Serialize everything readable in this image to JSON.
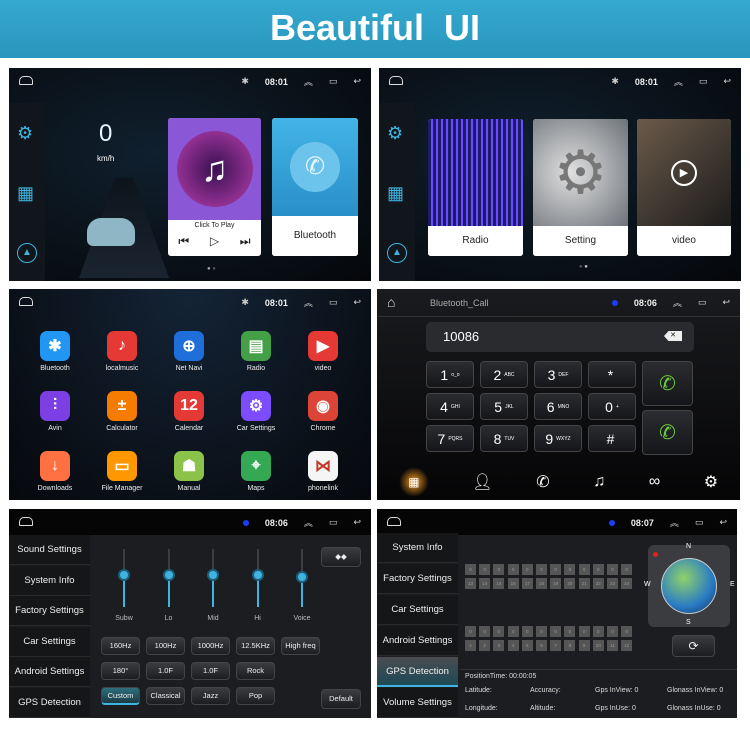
{
  "banner": {
    "title": "Beautiful  UI"
  },
  "home": {
    "time": "08:01",
    "speed": "0",
    "speed_unit": "km/h",
    "music_label": "Click To Play",
    "bt_label": "Bluetooth"
  },
  "home2": {
    "time": "08:01",
    "cards": [
      {
        "label": "Radio"
      },
      {
        "label": "Setting"
      },
      {
        "label": "video"
      }
    ]
  },
  "apps": {
    "time": "08:01",
    "items": [
      {
        "label": "Bluetooth",
        "color": "#2196f3",
        "icon": "bluetooth-icon",
        "glyph": "✱"
      },
      {
        "label": "localmusic",
        "color": "#e53935",
        "icon": "music-icon",
        "glyph": "♪"
      },
      {
        "label": "Net Navi",
        "color": "#1e6fd9",
        "icon": "navigation-icon",
        "glyph": "⊕"
      },
      {
        "label": "Radio",
        "color": "#43a047",
        "icon": "radio-icon",
        "glyph": "▤"
      },
      {
        "label": "video",
        "color": "#e53935",
        "icon": "video-icon",
        "glyph": "▶"
      },
      {
        "label": "Avin",
        "color": "#7b3fe4",
        "icon": "equalizer-icon",
        "glyph": "⫶"
      },
      {
        "label": "Calculator",
        "color": "#f57c00",
        "icon": "calculator-icon",
        "glyph": "±"
      },
      {
        "label": "Calendar",
        "color": "#e53935",
        "icon": "calendar-icon",
        "glyph": "12"
      },
      {
        "label": "Car Settings",
        "color": "#7c4dff",
        "icon": "gear-icon",
        "glyph": "⚙"
      },
      {
        "label": "Chrome",
        "color": "#db4437",
        "icon": "chrome-icon",
        "glyph": "◉"
      },
      {
        "label": "Downloads",
        "color": "#ff7043",
        "icon": "download-icon",
        "glyph": "↓"
      },
      {
        "label": "File Manager",
        "color": "#ff9800",
        "icon": "folder-icon",
        "glyph": "▭"
      },
      {
        "label": "Manual",
        "color": "#8bc34a",
        "icon": "android-icon",
        "glyph": "☗"
      },
      {
        "label": "Maps",
        "color": "#34a853",
        "icon": "maps-icon",
        "glyph": "⌖"
      },
      {
        "label": "phonelink",
        "color": "#f5f5f5",
        "icon": "phonelink-icon",
        "glyph": "⋈"
      }
    ]
  },
  "dialer": {
    "title": "Bluetooth_Call",
    "time": "08:06",
    "number": "10086",
    "keys": [
      {
        "d": "1",
        "s": "ᴏ_ᴏ"
      },
      {
        "d": "2",
        "s": "ABC"
      },
      {
        "d": "3",
        "s": "DEF"
      },
      {
        "d": "*",
        "s": ""
      },
      {
        "d": "4",
        "s": "GHI"
      },
      {
        "d": "5",
        "s": "JKL"
      },
      {
        "d": "6",
        "s": "MNO"
      },
      {
        "d": "0",
        "s": "+"
      },
      {
        "d": "7",
        "s": "PQRS"
      },
      {
        "d": "8",
        "s": "TUV"
      },
      {
        "d": "9",
        "s": "WXYZ"
      },
      {
        "d": "#",
        "s": ""
      }
    ],
    "tabs": [
      "dialpad-icon",
      "contacts-icon",
      "call-log-icon",
      "music-icon",
      "link-icon",
      "gear-icon"
    ],
    "active_tab": "#f39a1e",
    "call_color": "#6cc93a"
  },
  "sound": {
    "time": "08:06",
    "menu": [
      "Sound Settings",
      "System Info",
      "Factory Settings",
      "Car Settings",
      "Android Settings",
      "GPS Detection"
    ],
    "sliders": [
      {
        "label": "Subw",
        "level": 0.55
      },
      {
        "label": "Lo",
        "level": 0.55
      },
      {
        "label": "Mid",
        "level": 0.55
      },
      {
        "label": "Hi",
        "level": 0.55
      },
      {
        "label": "Voice",
        "level": 0.52
      }
    ],
    "row1": [
      "160Hz",
      "100Hz",
      "1000Hz",
      "12.5KHz",
      "High freq"
    ],
    "row2": [
      "180°",
      "1.0F",
      "1.0F",
      "Rock"
    ],
    "row3": [
      "Custom",
      "Classical",
      "Jazz",
      "Pop"
    ],
    "selected_preset": "Custom",
    "default_label": "Default",
    "accent": "#3fb4e0"
  },
  "gps": {
    "time": "08:07",
    "menu": [
      "System Info",
      "Factory Settings",
      "Car Settings",
      "Android Settings",
      "GPS Detection",
      "Volume Settings"
    ],
    "active": "GPS Detection",
    "top_values": [
      "0",
      "0",
      "0",
      "0",
      "0",
      "0",
      "0",
      "0",
      "0",
      "0",
      "0",
      "0"
    ],
    "top_ids": [
      "13",
      "14",
      "15",
      "16",
      "17",
      "18",
      "19",
      "20",
      "21",
      "22",
      "23",
      "24"
    ],
    "bot_values": [
      "0",
      "0",
      "0",
      "0",
      "0",
      "0",
      "0",
      "0",
      "0",
      "0",
      "0",
      "0"
    ],
    "bot_ids": [
      "1",
      "2",
      "3",
      "4",
      "5",
      "6",
      "7",
      "8",
      "9",
      "10",
      "11",
      "12"
    ],
    "compass": {
      "n": "N",
      "s": "S",
      "e": "E",
      "w": "W"
    },
    "position_time": "PositionTime: 00:00:05",
    "fields": [
      "Latitude:",
      "Accuracy:",
      "Gps InView: 0",
      "Glonass InView: 0",
      "Longitude:",
      "Altitude:",
      "Gps InUse: 0",
      "Glonass InUse: 0"
    ]
  }
}
